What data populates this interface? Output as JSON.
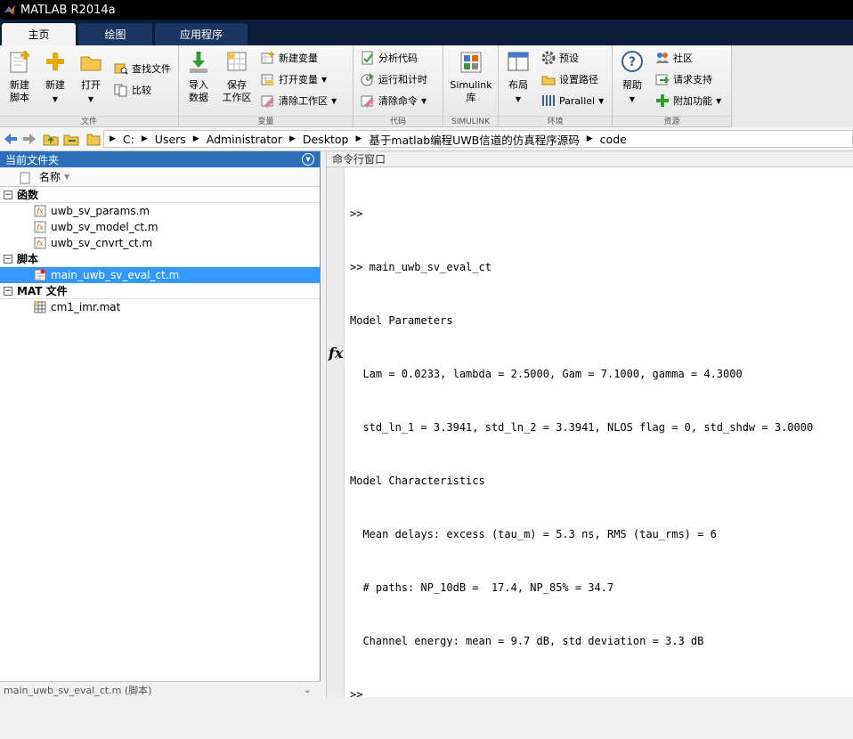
{
  "window": {
    "title": "MATLAB R2014a"
  },
  "tabs": [
    {
      "label": "主页"
    },
    {
      "label": "绘图"
    },
    {
      "label": "应用程序"
    }
  ],
  "ribbon": {
    "file": {
      "new_script": "新建\n脚本",
      "new": "新建",
      "open": "打开",
      "find_files": "查找文件",
      "compare": "比较",
      "label": "文件"
    },
    "variable": {
      "import": "导入\n数据",
      "save_workspace": "保存\n工作区",
      "new_variable": "新建变量",
      "open_variable": "打开变量",
      "clear_workspace": "清除工作区",
      "label": "变量"
    },
    "code": {
      "analyze": "分析代码",
      "run_time": "运行和计时",
      "clear_commands": "清除命令",
      "label": "代码"
    },
    "simulink": {
      "button": "Simulink\n库",
      "label": "SIMULINK"
    },
    "environment": {
      "layout": "布局",
      "preferences": "预设",
      "set_path": "设置路径",
      "parallel": "Parallel",
      "label": "环境"
    },
    "resources": {
      "help": "帮助",
      "community": "社区",
      "request_support": "请求支持",
      "addons": "附加功能",
      "label": "资源"
    }
  },
  "address": {
    "parts": [
      "C:",
      "Users",
      "Administrator",
      "Desktop",
      "基于matlab编程UWB信道的仿真程序源码",
      "code"
    ]
  },
  "left_pane": {
    "title": "当前文件夹",
    "column_name": "名称",
    "sections": [
      {
        "label": "函数",
        "files": [
          "uwb_sv_params.m",
          "uwb_sv_model_ct.m",
          "uwb_sv_cnvrt_ct.m"
        ]
      },
      {
        "label": "脚本",
        "files": [
          "main_uwb_sv_eval_ct.m"
        ]
      },
      {
        "label": "MAT 文件",
        "files": [
          "cm1_imr.mat"
        ]
      }
    ],
    "selected_file": "main_uwb_sv_eval_ct.m",
    "status_text": "main_uwb_sv_eval_ct.m (脚本)"
  },
  "command_window": {
    "title": "命令行窗口",
    "lines": [
      ">>",
      ">> main_uwb_sv_eval_ct",
      "Model Parameters",
      "  Lam = 0.0233, lambda = 2.5000, Gam = 7.1000, gamma = 4.3000",
      "  std_ln_1 = 3.3941, std_ln_2 = 3.3941, NLOS flag = 0, std_shdw = 3.0000",
      "Model Characteristics",
      "  Mean delays: excess (tau_m) = 5.3 ns, RMS (tau_rms) = 6",
      "  # paths: NP_10dB =  17.4, NP_85% = 34.7",
      "  Channel energy: mean = 9.7 dB, std deviation = 3.3 dB",
      ">>"
    ],
    "fx_symbol": "fx"
  }
}
